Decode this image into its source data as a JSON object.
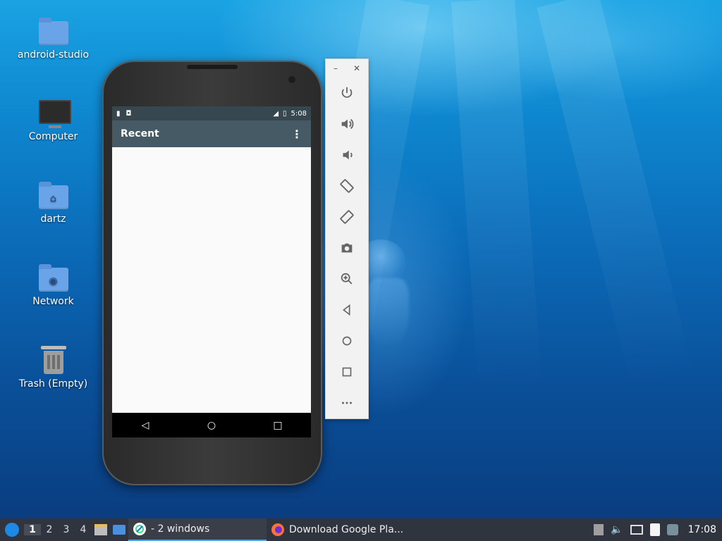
{
  "desktop": {
    "icons": [
      {
        "label": "android-studio",
        "icon": "folder-icon"
      },
      {
        "label": "Computer",
        "icon": "computer-icon"
      },
      {
        "label": "dartz",
        "icon": "home-folder-icon"
      },
      {
        "label": "Network",
        "icon": "network-folder-icon"
      },
      {
        "label": "Trash (Empty)",
        "icon": "trash-icon"
      }
    ]
  },
  "emulator": {
    "status_time": "5:08",
    "app_title": "Recent",
    "toolbar": [
      "power-icon",
      "volume-up-icon",
      "volume-down-icon",
      "rotate-left-icon",
      "rotate-right-icon",
      "camera-icon",
      "zoom-icon",
      "back-icon",
      "home-icon",
      "overview-icon",
      "more-icon"
    ]
  },
  "taskbar": {
    "workspaces": [
      "1",
      "2",
      "3",
      "4"
    ],
    "tasks": [
      {
        "label": "- 2 windows"
      },
      {
        "label": "Download Google Pla..."
      }
    ],
    "clock": "17:08"
  }
}
